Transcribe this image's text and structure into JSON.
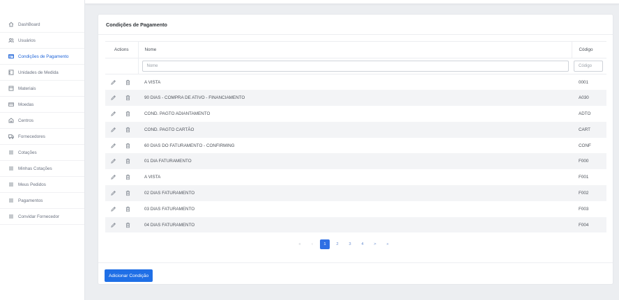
{
  "sidebar": {
    "items": [
      {
        "label": "DashBoard",
        "icon": "home-icon",
        "active": false
      },
      {
        "label": "Usuários",
        "icon": "users-icon",
        "active": false
      },
      {
        "label": "Condições de Pagamento",
        "icon": "card-icon",
        "active": true
      },
      {
        "label": "Unidades de Medida",
        "icon": "ruler-icon",
        "active": false
      },
      {
        "label": "Materiais",
        "icon": "box-icon",
        "active": false
      },
      {
        "label": "Moedas",
        "icon": "wallet-icon",
        "active": false
      },
      {
        "label": "Centros",
        "icon": "building-icon",
        "active": false
      },
      {
        "label": "Fornecedores",
        "icon": "truck-icon",
        "active": false
      },
      {
        "label": "Cotações",
        "icon": "list-icon",
        "active": false
      },
      {
        "label": "Minhas Cotações",
        "icon": "list-icon",
        "active": false
      },
      {
        "label": "Meus Pedidos",
        "icon": "list-icon",
        "active": false
      },
      {
        "label": "Pagamentos",
        "icon": "list-icon",
        "active": false
      },
      {
        "label": "Convidar Fornecedor",
        "icon": "list-icon",
        "active": false
      }
    ]
  },
  "card": {
    "title": "Condições de Pagamento",
    "add_button_label": "Adicionar Condição"
  },
  "table": {
    "headers": {
      "actions": "Actions",
      "nome": "Nome",
      "codigo": "Código"
    },
    "filters": {
      "nome_placeholder": "Nome",
      "codigo_placeholder": "Código"
    },
    "rows": [
      {
        "nome": "A VISTA",
        "codigo": "0001"
      },
      {
        "nome": "90 DIAS - COMPRA DE ATIVO - FINANCIAMENTO",
        "codigo": "A030"
      },
      {
        "nome": "COND. PAGTO ADIANTAMENTO",
        "codigo": "ADTO"
      },
      {
        "nome": "COND. PAGTO CARTÃO",
        "codigo": "CART"
      },
      {
        "nome": "60 DIAS DO FATURAMENTO - CONFIRMING",
        "codigo": "CONF"
      },
      {
        "nome": "01 DIA FATURAMENTO",
        "codigo": "F000"
      },
      {
        "nome": "A VISTA",
        "codigo": "F001"
      },
      {
        "nome": "02 DIAS FATURAMENTO",
        "codigo": "F002"
      },
      {
        "nome": "03 DIAS FATURAMENTO",
        "codigo": "F003"
      },
      {
        "nome": "04 DIAS FATURAMENTO",
        "codigo": "F004"
      }
    ]
  },
  "pagination": {
    "first": "«",
    "prev": "‹",
    "pages": [
      "1",
      "2",
      "3",
      "4"
    ],
    "current": "1",
    "next": ">",
    "last": "»"
  },
  "colors": {
    "accent": "#1f6fe6",
    "active_nav": "#1d63d8",
    "row_alt": "#f3f4f6"
  }
}
